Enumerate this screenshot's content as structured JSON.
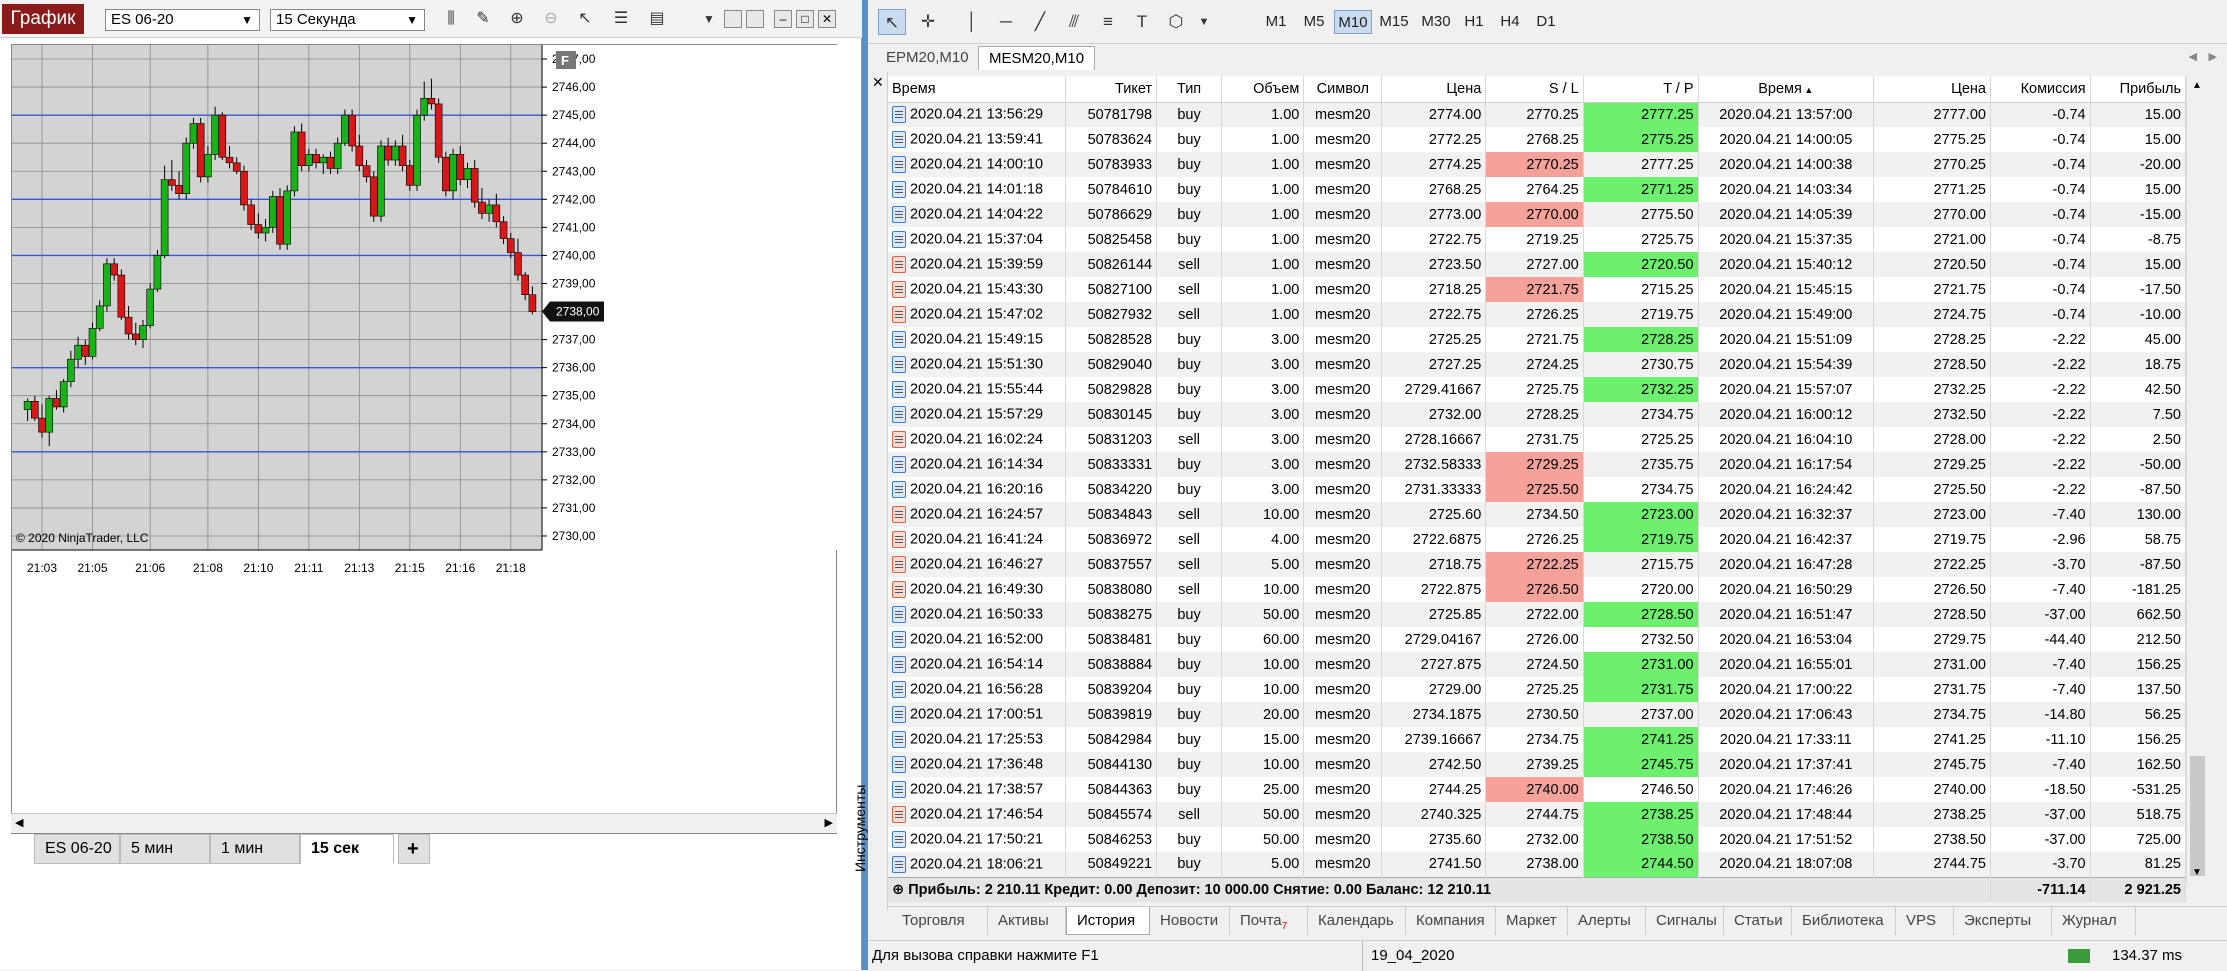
{
  "left": {
    "app_button": "График",
    "instrument": "ES 06-20",
    "period": "15 Секунда",
    "tabs": [
      "ES 06-20",
      "5 мин",
      "1 мин",
      "15 сек"
    ],
    "add_tab": "+",
    "copyright": "© 2020 NinjaTrader, LLC",
    "f_badge": "F"
  },
  "chart_data": {
    "type": "candlestick",
    "x_tick_labels": [
      "21:03",
      "21:05",
      "21:06",
      "21:08",
      "21:10",
      "21:11",
      "21:13",
      "21:15",
      "21:16",
      "21:18"
    ],
    "y_tick_labels": [
      "2747,00",
      "2746,00",
      "2745,00",
      "2744,00",
      "2743,00",
      "2742,00",
      "2741,00",
      "2740,00",
      "2739,00",
      "2738,00",
      "2737,00",
      "2736,00",
      "2735,00",
      "2734,00",
      "2733,00",
      "2732,00",
      "2731,00",
      "2730,00"
    ],
    "ylim": [
      2729.5,
      2747.5
    ],
    "last_price_label": "2738,00",
    "last_price": 2738.0,
    "hlines": [
      2745.0,
      2742.0,
      2740.0,
      2736.0,
      2733.0
    ],
    "colors": {
      "up": "#19b219",
      "down": "#d81818",
      "hline": "#3a56d6",
      "bg": "#d3d3d3"
    },
    "candles": [
      [
        2734.5,
        2734.9,
        2734.1,
        2734.8
      ],
      [
        2734.8,
        2735.0,
        2734.1,
        2734.2
      ],
      [
        2734.2,
        2734.7,
        2733.5,
        2733.7
      ],
      [
        2733.7,
        2735.0,
        2733.2,
        2734.9
      ],
      [
        2734.9,
        2735.2,
        2734.5,
        2734.6
      ],
      [
        2734.6,
        2735.6,
        2734.4,
        2735.5
      ],
      [
        2735.5,
        2736.6,
        2735.3,
        2736.3
      ],
      [
        2736.3,
        2737.1,
        2736.0,
        2736.8
      ],
      [
        2736.8,
        2737.0,
        2736.1,
        2736.4
      ],
      [
        2736.4,
        2737.6,
        2736.3,
        2737.4
      ],
      [
        2737.4,
        2738.4,
        2737.3,
        2738.2
      ],
      [
        2738.2,
        2739.9,
        2738.0,
        2739.7
      ],
      [
        2739.7,
        2739.9,
        2739.1,
        2739.3
      ],
      [
        2739.3,
        2739.5,
        2737.7,
        2737.8
      ],
      [
        2737.8,
        2738.2,
        2737.0,
        2737.2
      ],
      [
        2737.2,
        2737.6,
        2736.8,
        2737.0
      ],
      [
        2737.0,
        2737.7,
        2736.7,
        2737.5
      ],
      [
        2737.5,
        2739.0,
        2737.4,
        2738.8
      ],
      [
        2738.8,
        2740.2,
        2738.7,
        2740.0
      ],
      [
        2740.0,
        2743.2,
        2739.9,
        2742.7
      ],
      [
        2742.7,
        2743.4,
        2742.3,
        2742.5
      ],
      [
        2742.5,
        2743.0,
        2742.0,
        2742.2
      ],
      [
        2742.2,
        2744.2,
        2742.0,
        2744.0
      ],
      [
        2744.0,
        2744.9,
        2743.8,
        2744.7
      ],
      [
        2744.7,
        2744.9,
        2742.6,
        2742.8
      ],
      [
        2742.8,
        2743.9,
        2742.6,
        2743.6
      ],
      [
        2743.6,
        2745.3,
        2743.4,
        2745.0
      ],
      [
        2745.0,
        2745.1,
        2743.4,
        2743.5
      ],
      [
        2743.5,
        2743.9,
        2743.1,
        2743.3
      ],
      [
        2743.3,
        2743.5,
        2742.9,
        2743.0
      ],
      [
        2743.0,
        2743.2,
        2741.6,
        2741.8
      ],
      [
        2741.8,
        2742.0,
        2740.9,
        2741.1
      ],
      [
        2741.1,
        2741.5,
        2740.6,
        2740.8
      ],
      [
        2740.8,
        2741.3,
        2740.5,
        2741.0
      ],
      [
        2741.0,
        2742.3,
        2740.8,
        2742.1
      ],
      [
        2742.1,
        2742.4,
        2740.2,
        2740.4
      ],
      [
        2740.4,
        2742.5,
        2740.2,
        2742.3
      ],
      [
        2742.3,
        2744.6,
        2742.1,
        2744.4
      ],
      [
        2744.4,
        2744.7,
        2743.0,
        2743.2
      ],
      [
        2743.2,
        2743.8,
        2743.0,
        2743.6
      ],
      [
        2743.6,
        2743.8,
        2743.1,
        2743.3
      ],
      [
        2743.3,
        2743.6,
        2742.9,
        2743.5
      ],
      [
        2743.5,
        2743.7,
        2742.9,
        2743.1
      ],
      [
        2743.1,
        2744.2,
        2742.9,
        2744.0
      ],
      [
        2744.0,
        2745.2,
        2743.9,
        2745.0
      ],
      [
        2745.0,
        2745.2,
        2743.7,
        2743.9
      ],
      [
        2743.9,
        2744.3,
        2743.0,
        2743.2
      ],
      [
        2743.2,
        2743.4,
        2742.6,
        2742.8
      ],
      [
        2742.8,
        2743.0,
        2741.2,
        2741.4
      ],
      [
        2741.4,
        2744.1,
        2741.2,
        2743.9
      ],
      [
        2743.9,
        2744.2,
        2743.2,
        2743.4
      ],
      [
        2743.4,
        2744.1,
        2743.2,
        2743.9
      ],
      [
        2743.9,
        2744.3,
        2743.0,
        2743.2
      ],
      [
        2743.2,
        2743.4,
        2742.3,
        2742.5
      ],
      [
        2742.5,
        2745.2,
        2742.3,
        2745.0
      ],
      [
        2745.0,
        2746.2,
        2744.8,
        2745.6
      ],
      [
        2745.6,
        2746.3,
        2745.2,
        2745.4
      ],
      [
        2745.4,
        2745.6,
        2743.3,
        2743.5
      ],
      [
        2743.5,
        2743.7,
        2742.1,
        2742.3
      ],
      [
        2742.3,
        2743.8,
        2742.0,
        2743.6
      ],
      [
        2743.6,
        2743.9,
        2742.5,
        2742.7
      ],
      [
        2742.7,
        2743.3,
        2742.4,
        2743.1
      ],
      [
        2743.1,
        2743.4,
        2741.7,
        2741.9
      ],
      [
        2741.9,
        2742.4,
        2741.3,
        2741.5
      ],
      [
        2741.5,
        2742.0,
        2741.2,
        2741.8
      ],
      [
        2741.8,
        2742.2,
        2741.0,
        2741.2
      ],
      [
        2741.2,
        2741.4,
        2740.4,
        2740.6
      ],
      [
        2740.6,
        2740.8,
        2739.9,
        2740.1
      ],
      [
        2740.1,
        2740.6,
        2739.1,
        2739.3
      ],
      [
        2739.3,
        2739.4,
        2738.4,
        2738.6
      ],
      [
        2738.6,
        2738.9,
        2737.9,
        2738.0
      ]
    ]
  },
  "right": {
    "timeframes": [
      "M1",
      "M5",
      "M10",
      "M15",
      "M30",
      "H1",
      "H4",
      "D1"
    ],
    "active_timeframe": "M10",
    "doc_tabs": [
      "EPM20,M10",
      "MESM20,M10"
    ],
    "active_doc_tab": "MESM20,M10",
    "columns": [
      "Время",
      "Тикет",
      "Тип",
      "Объем",
      "Символ",
      "Цена",
      "S / L",
      "T / P",
      "Время",
      "Цена",
      "Комиссия",
      "Прибыль"
    ],
    "rows": [
      [
        "2020.04.21 13:56:29",
        "50781798",
        "buy",
        "1.00",
        "mesm20",
        "2774.00",
        "2770.25",
        "2777.25",
        "2020.04.21 13:57:00",
        "2777.00",
        "-0.74",
        "15.00",
        "",
        "green"
      ],
      [
        "2020.04.21 13:59:41",
        "50783624",
        "buy",
        "1.00",
        "mesm20",
        "2772.25",
        "2768.25",
        "2775.25",
        "2020.04.21 14:00:05",
        "2775.25",
        "-0.74",
        "15.00",
        "",
        "green"
      ],
      [
        "2020.04.21 14:00:10",
        "50783933",
        "buy",
        "1.00",
        "mesm20",
        "2774.25",
        "2770.25",
        "2777.25",
        "2020.04.21 14:00:38",
        "2770.25",
        "-0.74",
        "-20.00",
        "red",
        ""
      ],
      [
        "2020.04.21 14:01:18",
        "50784610",
        "buy",
        "1.00",
        "mesm20",
        "2768.25",
        "2764.25",
        "2771.25",
        "2020.04.21 14:03:34",
        "2771.25",
        "-0.74",
        "15.00",
        "",
        "green"
      ],
      [
        "2020.04.21 14:04:22",
        "50786629",
        "buy",
        "1.00",
        "mesm20",
        "2773.00",
        "2770.00",
        "2775.50",
        "2020.04.21 14:05:39",
        "2770.00",
        "-0.74",
        "-15.00",
        "red",
        ""
      ],
      [
        "2020.04.21 15:37:04",
        "50825458",
        "buy",
        "1.00",
        "mesm20",
        "2722.75",
        "2719.25",
        "2725.75",
        "2020.04.21 15:37:35",
        "2721.00",
        "-0.74",
        "-8.75",
        "",
        ""
      ],
      [
        "2020.04.21 15:39:59",
        "50826144",
        "sell",
        "1.00",
        "mesm20",
        "2723.50",
        "2727.00",
        "2720.50",
        "2020.04.21 15:40:12",
        "2720.50",
        "-0.74",
        "15.00",
        "",
        "green"
      ],
      [
        "2020.04.21 15:43:30",
        "50827100",
        "sell",
        "1.00",
        "mesm20",
        "2718.25",
        "2721.75",
        "2715.25",
        "2020.04.21 15:45:15",
        "2721.75",
        "-0.74",
        "-17.50",
        "red",
        ""
      ],
      [
        "2020.04.21 15:47:02",
        "50827932",
        "sell",
        "1.00",
        "mesm20",
        "2722.75",
        "2726.25",
        "2719.75",
        "2020.04.21 15:49:00",
        "2724.75",
        "-0.74",
        "-10.00",
        "",
        ""
      ],
      [
        "2020.04.21 15:49:15",
        "50828528",
        "buy",
        "3.00",
        "mesm20",
        "2725.25",
        "2721.75",
        "2728.25",
        "2020.04.21 15:51:09",
        "2728.25",
        "-2.22",
        "45.00",
        "",
        "green"
      ],
      [
        "2020.04.21 15:51:30",
        "50829040",
        "buy",
        "3.00",
        "mesm20",
        "2727.25",
        "2724.25",
        "2730.75",
        "2020.04.21 15:54:39",
        "2728.50",
        "-2.22",
        "18.75",
        "",
        ""
      ],
      [
        "2020.04.21 15:55:44",
        "50829828",
        "buy",
        "3.00",
        "mesm20",
        "2729.41667",
        "2725.75",
        "2732.25",
        "2020.04.21 15:57:07",
        "2732.25",
        "-2.22",
        "42.50",
        "",
        "green"
      ],
      [
        "2020.04.21 15:57:29",
        "50830145",
        "buy",
        "3.00",
        "mesm20",
        "2732.00",
        "2728.25",
        "2734.75",
        "2020.04.21 16:00:12",
        "2732.50",
        "-2.22",
        "7.50",
        "",
        ""
      ],
      [
        "2020.04.21 16:02:24",
        "50831203",
        "sell",
        "3.00",
        "mesm20",
        "2728.16667",
        "2731.75",
        "2725.25",
        "2020.04.21 16:04:10",
        "2728.00",
        "-2.22",
        "2.50",
        "",
        ""
      ],
      [
        "2020.04.21 16:14:34",
        "50833331",
        "buy",
        "3.00",
        "mesm20",
        "2732.58333",
        "2729.25",
        "2735.75",
        "2020.04.21 16:17:54",
        "2729.25",
        "-2.22",
        "-50.00",
        "red",
        ""
      ],
      [
        "2020.04.21 16:20:16",
        "50834220",
        "buy",
        "3.00",
        "mesm20",
        "2731.33333",
        "2725.50",
        "2734.75",
        "2020.04.21 16:24:42",
        "2725.50",
        "-2.22",
        "-87.50",
        "red",
        ""
      ],
      [
        "2020.04.21 16:24:57",
        "50834843",
        "sell",
        "10.00",
        "mesm20",
        "2725.60",
        "2734.50",
        "2723.00",
        "2020.04.21 16:32:37",
        "2723.00",
        "-7.40",
        "130.00",
        "",
        "green"
      ],
      [
        "2020.04.21 16:41:24",
        "50836972",
        "sell",
        "4.00",
        "mesm20",
        "2722.6875",
        "2726.25",
        "2719.75",
        "2020.04.21 16:42:37",
        "2719.75",
        "-2.96",
        "58.75",
        "",
        "green"
      ],
      [
        "2020.04.21 16:46:27",
        "50837557",
        "sell",
        "5.00",
        "mesm20",
        "2718.75",
        "2722.25",
        "2715.75",
        "2020.04.21 16:47:28",
        "2722.25",
        "-3.70",
        "-87.50",
        "red",
        ""
      ],
      [
        "2020.04.21 16:49:30",
        "50838080",
        "sell",
        "10.00",
        "mesm20",
        "2722.875",
        "2726.50",
        "2720.00",
        "2020.04.21 16:50:29",
        "2726.50",
        "-7.40",
        "-181.25",
        "red",
        ""
      ],
      [
        "2020.04.21 16:50:33",
        "50838275",
        "buy",
        "50.00",
        "mesm20",
        "2725.85",
        "2722.00",
        "2728.50",
        "2020.04.21 16:51:47",
        "2728.50",
        "-37.00",
        "662.50",
        "",
        "green"
      ],
      [
        "2020.04.21 16:52:00",
        "50838481",
        "buy",
        "60.00",
        "mesm20",
        "2729.04167",
        "2726.00",
        "2732.50",
        "2020.04.21 16:53:04",
        "2729.75",
        "-44.40",
        "212.50",
        "",
        ""
      ],
      [
        "2020.04.21 16:54:14",
        "50838884",
        "buy",
        "10.00",
        "mesm20",
        "2727.875",
        "2724.50",
        "2731.00",
        "2020.04.21 16:55:01",
        "2731.00",
        "-7.40",
        "156.25",
        "",
        "green"
      ],
      [
        "2020.04.21 16:56:28",
        "50839204",
        "buy",
        "10.00",
        "mesm20",
        "2729.00",
        "2725.25",
        "2731.75",
        "2020.04.21 17:00:22",
        "2731.75",
        "-7.40",
        "137.50",
        "",
        "green"
      ],
      [
        "2020.04.21 17:00:51",
        "50839819",
        "buy",
        "20.00",
        "mesm20",
        "2734.1875",
        "2730.50",
        "2737.00",
        "2020.04.21 17:06:43",
        "2734.75",
        "-14.80",
        "56.25",
        "",
        ""
      ],
      [
        "2020.04.21 17:25:53",
        "50842984",
        "buy",
        "15.00",
        "mesm20",
        "2739.16667",
        "2734.75",
        "2741.25",
        "2020.04.21 17:33:11",
        "2741.25",
        "-11.10",
        "156.25",
        "",
        "green"
      ],
      [
        "2020.04.21 17:36:48",
        "50844130",
        "buy",
        "10.00",
        "mesm20",
        "2742.50",
        "2739.25",
        "2745.75",
        "2020.04.21 17:37:41",
        "2745.75",
        "-7.40",
        "162.50",
        "",
        "green"
      ],
      [
        "2020.04.21 17:38:57",
        "50844363",
        "buy",
        "25.00",
        "mesm20",
        "2744.25",
        "2740.00",
        "2746.50",
        "2020.04.21 17:46:26",
        "2740.00",
        "-18.50",
        "-531.25",
        "red",
        ""
      ],
      [
        "2020.04.21 17:46:54",
        "50845574",
        "sell",
        "50.00",
        "mesm20",
        "2740.325",
        "2744.75",
        "2738.25",
        "2020.04.21 17:48:44",
        "2738.25",
        "-37.00",
        "518.75",
        "",
        "green"
      ],
      [
        "2020.04.21 17:50:21",
        "50846253",
        "buy",
        "50.00",
        "mesm20",
        "2735.60",
        "2732.00",
        "2738.50",
        "2020.04.21 17:51:52",
        "2738.50",
        "-37.00",
        "725.00",
        "",
        "green"
      ],
      [
        "2020.04.21 18:06:21",
        "50849221",
        "buy",
        "5.00",
        "mesm20",
        "2741.50",
        "2738.00",
        "2744.50",
        "2020.04.21 18:07:08",
        "2744.75",
        "-3.70",
        "81.25",
        "",
        "green"
      ]
    ],
    "summary": {
      "text": "Прибыль: 2 210.11  Кредит: 0.00  Депозит: 10 000.00  Снятие: 0.00  Баланс: 12 210.11",
      "commission": "-711.14",
      "profit": "2 921.25"
    },
    "side_label": "Инструменты",
    "bottom_tabs": [
      "Торговля",
      "Активы",
      "История",
      "Новости",
      "Почта",
      "Календарь",
      "Компания",
      "Маркет",
      "Алерты",
      "Сигналы",
      "Статьи",
      "Библиотека",
      "VPS",
      "Эксперты",
      "Журнал"
    ],
    "mail_count": "7",
    "active_bottom_tab": "История",
    "status_help": "Для вызова справки нажмите F1",
    "status_profile": "19_04_2020",
    "status_ping": "134.37 ms"
  }
}
